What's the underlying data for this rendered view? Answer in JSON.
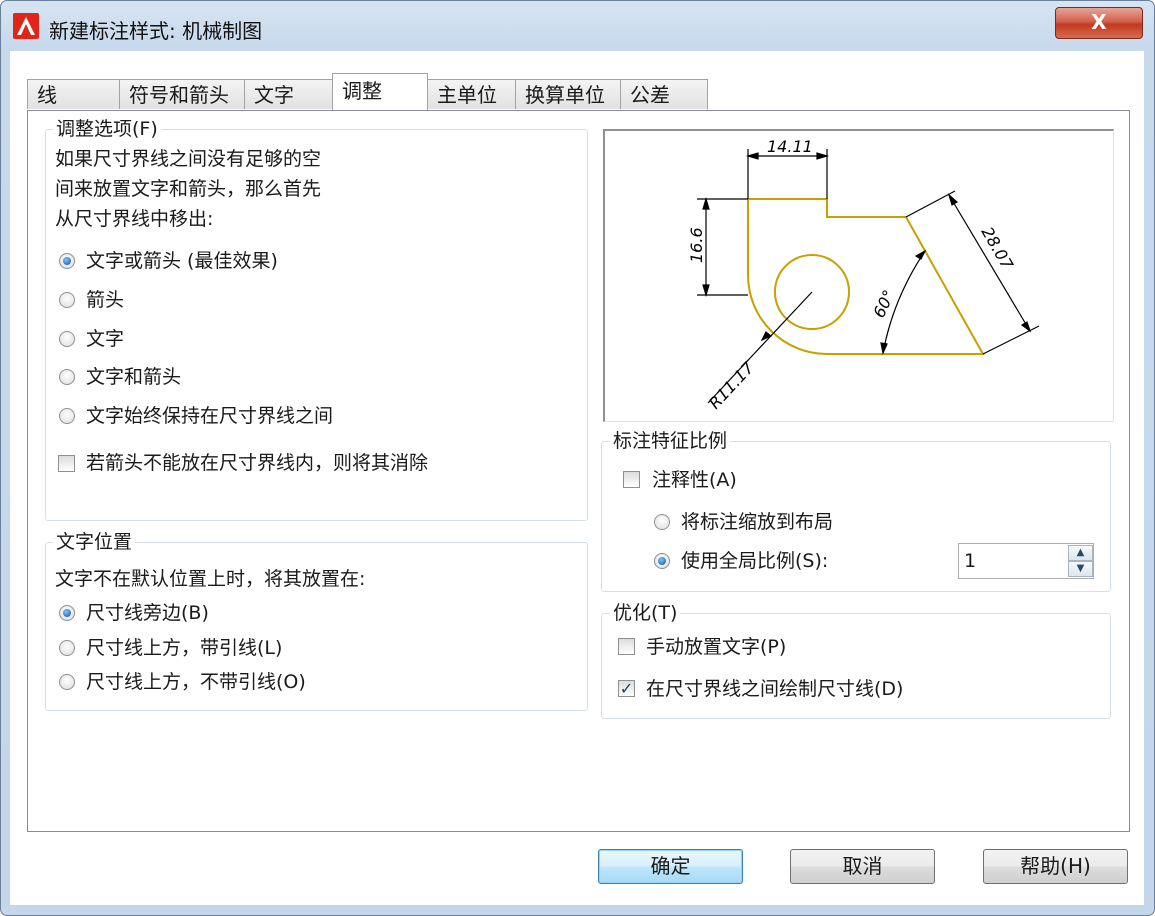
{
  "window": {
    "title": "新建标注样式: 机械制图",
    "close_label": "X"
  },
  "tabs": [
    {
      "label": "线"
    },
    {
      "label": "符号和箭头"
    },
    {
      "label": "文字"
    },
    {
      "label": "调整",
      "active": true
    },
    {
      "label": "主单位"
    },
    {
      "label": "换算单位"
    },
    {
      "label": "公差"
    }
  ],
  "fit_options": {
    "legend": "调整选项(F)",
    "description": [
      "如果尺寸界线之间没有足够的空",
      "间来放置文字和箭头，那么首先",
      "从尺寸界线中移出:"
    ],
    "radios": [
      {
        "label": "文字或箭头 (最佳效果)",
        "selected": true
      },
      {
        "label": "箭头",
        "selected": false
      },
      {
        "label": "文字",
        "selected": false
      },
      {
        "label": "文字和箭头",
        "selected": false
      },
      {
        "label": "文字始终保持在尺寸界线之间",
        "selected": false
      }
    ],
    "suppress_checkbox": {
      "label": "若箭头不能放在尺寸界线内，则将其消除",
      "checked": false
    }
  },
  "text_placement": {
    "legend": "文字位置",
    "description": "文字不在默认位置上时，将其放置在:",
    "radios": [
      {
        "label": "尺寸线旁边(B)",
        "selected": true
      },
      {
        "label": "尺寸线上方，带引线(L)",
        "selected": false
      },
      {
        "label": "尺寸线上方，不带引线(O)",
        "selected": false
      }
    ]
  },
  "preview": {
    "labels": {
      "top_width": "14.11",
      "left_height": "16.6",
      "diagonal": "28.07",
      "angle": "60°",
      "radius": "R11.17"
    },
    "line_color": "#c8a000"
  },
  "scale": {
    "legend": "标注特征比例",
    "annotative": {
      "label": "注释性(A)",
      "checked": false
    },
    "scale_to_layout": {
      "label": "将标注缩放到布局",
      "selected": false
    },
    "use_overall": {
      "label": "使用全局比例(S):",
      "selected": true
    },
    "overall_value": "1"
  },
  "finetune": {
    "legend": "优化(T)",
    "manual_place": {
      "label": "手动放置文字(P)",
      "checked": false
    },
    "draw_between": {
      "label": "在尺寸界线之间绘制尺寸线(D)",
      "checked": true
    }
  },
  "buttons": {
    "ok": "确定",
    "cancel": "取消",
    "help": "帮助(H)"
  },
  "colors": {
    "accent": "#3c7fb1",
    "title_bar": "#c8d9ec",
    "close_red": "#c2391f"
  }
}
